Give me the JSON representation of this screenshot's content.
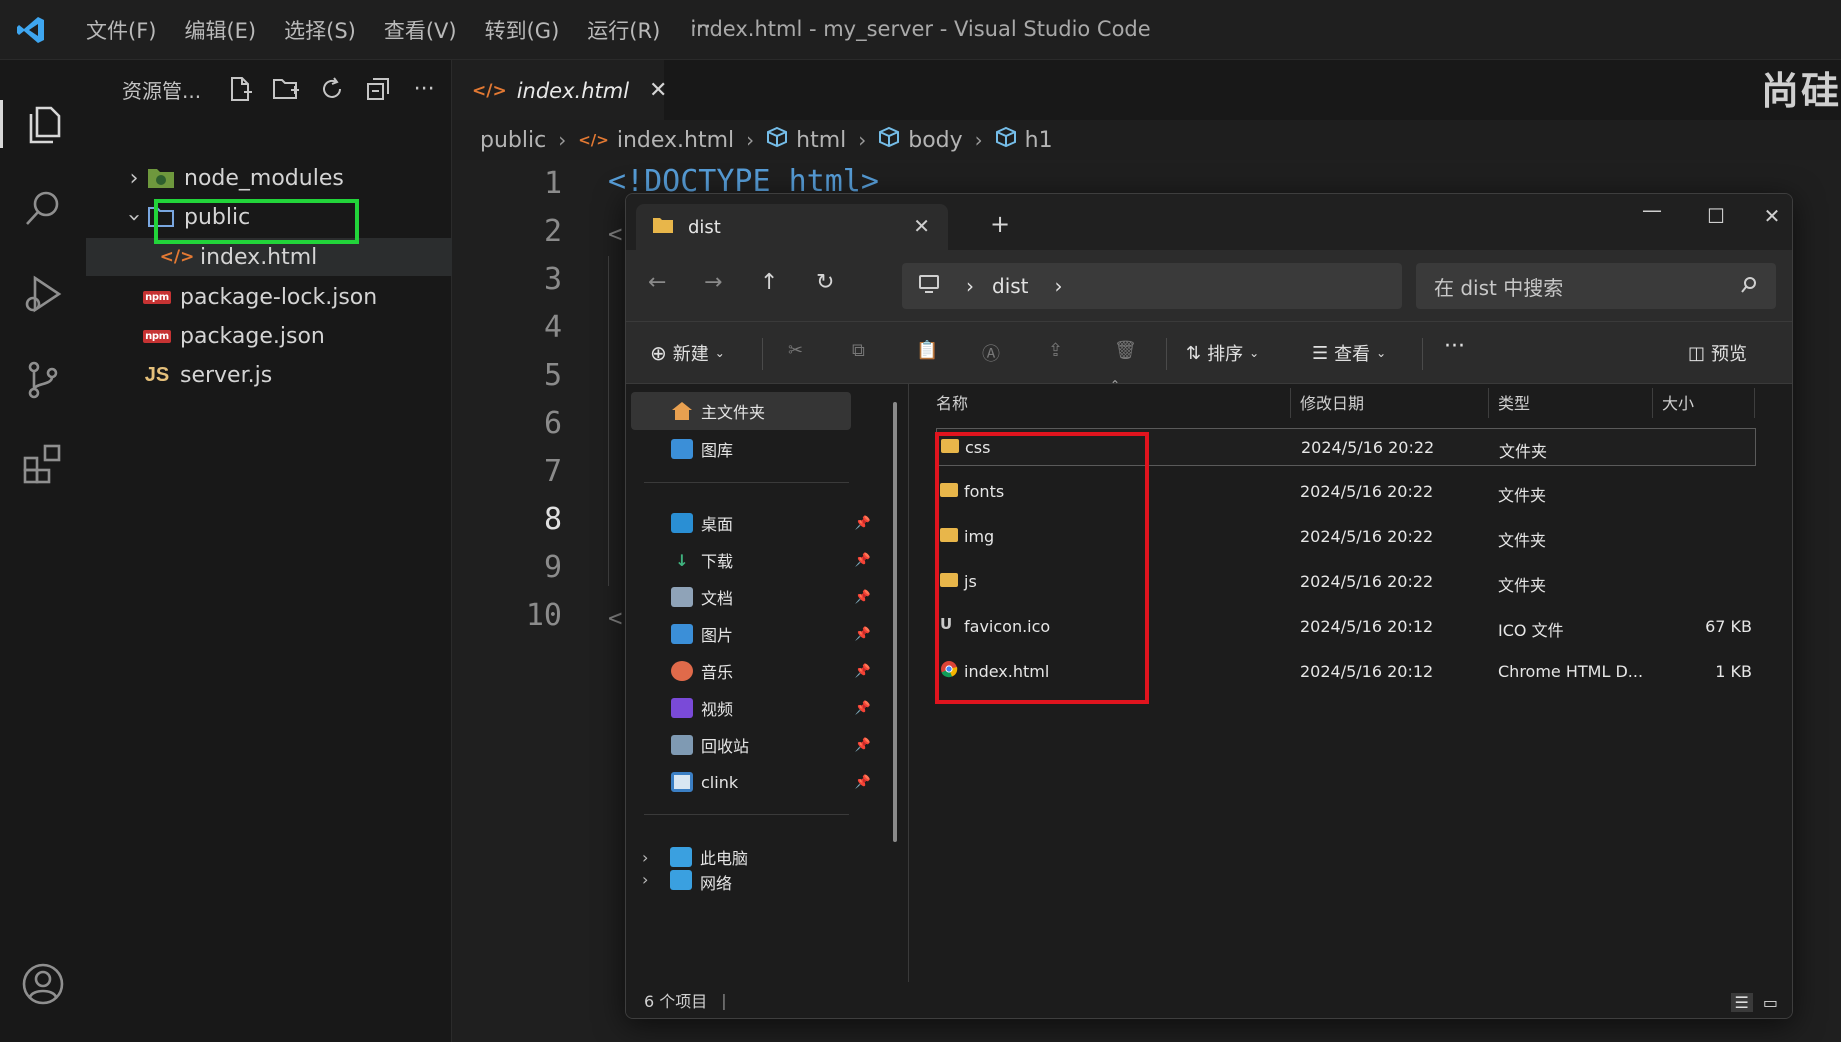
{
  "window": {
    "title": "index.html - my_server - Visual Studio Code",
    "menu": [
      "文件(F)",
      "编辑(E)",
      "选择(S)",
      "查看(V)",
      "转到(G)",
      "运行(R)"
    ],
    "menu_more": "···"
  },
  "sidebar": {
    "title": "资源管...",
    "tree": [
      {
        "label": "node_modules",
        "type": "folder",
        "expanded": false
      },
      {
        "label": "public",
        "type": "folder",
        "expanded": true
      },
      {
        "label": "index.html",
        "type": "html",
        "selected": true
      },
      {
        "label": "package-lock.json",
        "type": "npm"
      },
      {
        "label": "package.json",
        "type": "npm"
      },
      {
        "label": "server.js",
        "type": "js"
      }
    ],
    "icons": {
      "npm": "npm",
      "js": "JS"
    }
  },
  "editor": {
    "tab_label": "index.html",
    "brand_text": "尚硅",
    "breadcrumb": [
      "public",
      "index.html",
      "html",
      "body",
      "h1"
    ],
    "line_numbers": [
      "1",
      "2",
      "3",
      "4",
      "5",
      "6",
      "7",
      "8",
      "9",
      "10"
    ],
    "current_line": "8",
    "code_line1": "<!DOCTYPE html>",
    "fold_glyph": "<"
  },
  "file_explorer": {
    "tab_label": "dist",
    "new_tab": "+",
    "address": [
      "dist"
    ],
    "search_placeholder": "在 dist 中搜索",
    "commands": {
      "new": "新建",
      "sort": "排序",
      "view": "查看",
      "more": "···",
      "preview": "预览"
    },
    "nav": {
      "home": "主文件夹",
      "gallery": "图库",
      "pinned": [
        "桌面",
        "下载",
        "文档",
        "图片",
        "音乐",
        "视频",
        "回收站",
        "clink"
      ],
      "this_pc": "此电脑",
      "network": "网络"
    },
    "columns": {
      "name": "名称",
      "modified": "修改日期",
      "type": "类型",
      "size": "大小"
    },
    "files": [
      {
        "name": "css",
        "modified": "2024/5/16 20:22",
        "type": "文件夹",
        "size": "",
        "kind": "folder"
      },
      {
        "name": "fonts",
        "modified": "2024/5/16 20:22",
        "type": "文件夹",
        "size": "",
        "kind": "folder"
      },
      {
        "name": "img",
        "modified": "2024/5/16 20:22",
        "type": "文件夹",
        "size": "",
        "kind": "folder"
      },
      {
        "name": "js",
        "modified": "2024/5/16 20:22",
        "type": "文件夹",
        "size": "",
        "kind": "folder"
      },
      {
        "name": "favicon.ico",
        "modified": "2024/5/16 20:12",
        "type": "ICO 文件",
        "size": "67 KB",
        "kind": "ico"
      },
      {
        "name": "index.html",
        "modified": "2024/5/16 20:12",
        "type": "Chrome HTML D...",
        "size": "1 KB",
        "kind": "chrome"
      }
    ],
    "status": "6 个项目",
    "status_sep": "|"
  },
  "colors": {
    "highlight_green": "#22d43a",
    "highlight_red": "#e0141e",
    "folder": "#e8b64a"
  }
}
